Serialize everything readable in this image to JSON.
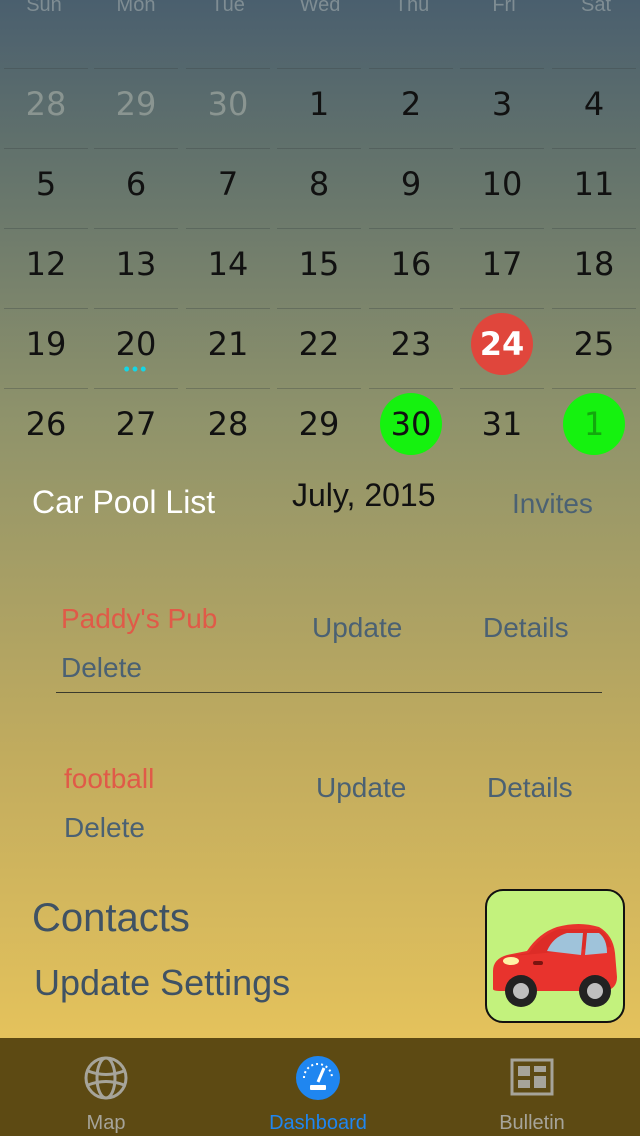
{
  "calendar": {
    "weekdays": [
      "Sun",
      "Mon",
      "Tue",
      "Wed",
      "Thu",
      "Fri",
      "Sat"
    ],
    "month_label": "July, 2015",
    "weeks": [
      [
        "28",
        "29",
        "30",
        "1",
        "2",
        "3",
        "4"
      ],
      [
        "5",
        "6",
        "7",
        "8",
        "9",
        "10",
        "11"
      ],
      [
        "12",
        "13",
        "14",
        "15",
        "16",
        "17",
        "18"
      ],
      [
        "19",
        "20",
        "21",
        "22",
        "23",
        "24",
        "25"
      ],
      [
        "26",
        "27",
        "28",
        "29",
        "30",
        "31",
        "1"
      ]
    ],
    "outside_month": [
      "0-0",
      "0-1",
      "0-2",
      "4-6"
    ],
    "today": "3-5",
    "event_days": [
      "4-4",
      "4-6"
    ],
    "dots_day": "3-1",
    "colors": {
      "today": "#e0463c",
      "event": "#15f20f",
      "dots": "#14d6e6"
    }
  },
  "carpool": {
    "title": "Car Pool List",
    "invites_label": "Invites",
    "items": [
      {
        "name": "Paddy's Pub",
        "update_label": "Update",
        "details_label": "Details",
        "delete_label": "Delete"
      },
      {
        "name": "football",
        "update_label": "Update",
        "details_label": "Details",
        "delete_label": "Delete"
      }
    ]
  },
  "links": {
    "contacts": "Contacts",
    "update_settings": "Update Settings"
  },
  "car_button": {
    "icon": "red-car-icon",
    "background": "#c3f27d"
  },
  "tabbar": {
    "tabs": [
      {
        "label": "Map",
        "icon": "globe-icon",
        "active": false
      },
      {
        "label": "Dashboard",
        "icon": "speedometer-icon",
        "active": true
      },
      {
        "label": "Bulletin",
        "icon": "bulletin-board-icon",
        "active": false
      }
    ],
    "colors": {
      "background": "#5d4a13",
      "active": "#1f86f0",
      "inactive": "#a6a49a"
    }
  }
}
